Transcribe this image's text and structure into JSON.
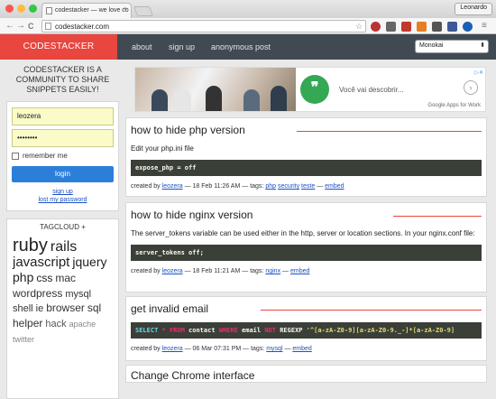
{
  "browser": {
    "tab_title": "codestacker — we love co",
    "tab_close": "×",
    "url": "codestacker.com",
    "user": "Leonardo",
    "back": "←",
    "forward": "→",
    "reload": "C",
    "star": "☆",
    "menu": "≡"
  },
  "header": {
    "brand": "CODESTACKER",
    "nav": [
      "about",
      "sign up",
      "anonymous post"
    ],
    "theme": "Monokai",
    "theme_arrow": "⬍"
  },
  "sidebar": {
    "tagline": "CODESTACKER IS A COMMUNITY TO SHARE SNIPPETS EASILY!",
    "username": "leozera",
    "password": "••••••••",
    "remember": "remember me",
    "login": "login",
    "signup": "sign up",
    "lost_password": "lost my password",
    "tagcloud_title": "TAGCLOUD +",
    "tags": [
      {
        "text": "ruby",
        "size": 20
      },
      {
        "text": "rails",
        "size": 16
      },
      {
        "text": "javascript",
        "size": 15
      },
      {
        "text": "jquery",
        "size": 14
      },
      {
        "text": "php",
        "size": 14
      },
      {
        "text": "css",
        "size": 12
      },
      {
        "text": "mac",
        "size": 12
      },
      {
        "text": "wordpress",
        "size": 12
      },
      {
        "text": "mysql",
        "size": 11
      },
      {
        "text": "shell",
        "size": 11
      },
      {
        "text": "ie",
        "size": 11
      },
      {
        "text": "browser",
        "size": 12
      },
      {
        "text": "sql",
        "size": 12
      },
      {
        "text": "helper",
        "size": 12
      },
      {
        "text": "hack",
        "size": 11
      },
      {
        "text": "apache",
        "size": 9
      },
      {
        "text": "twitter",
        "size": 9
      }
    ]
  },
  "ad": {
    "text": "Você vai descobrir...",
    "logo": "Google Apps for Work",
    "info": "▷✕"
  },
  "posts": [
    {
      "title": "how to hide php version",
      "desc": "Edit your php.ini file",
      "code": "expose_php = off",
      "meta_prefix": "created by",
      "author": "leozera",
      "date": "— 18 Feb 11:26 AM — tags:",
      "tags": [
        "php",
        "security",
        "teste"
      ],
      "sep": "—",
      "embed": "embed"
    },
    {
      "title": "how to hide nginx version",
      "desc": "The server_tokens variable can be used either in the http, server or location sections. In your nginx.conf file:",
      "code": "server_tokens off;",
      "meta_prefix": "created by",
      "author": "leozera",
      "date": "— 18 Feb 11:21 AM — tags:",
      "tags": [
        "nginx"
      ],
      "sep": "—",
      "embed": "embed"
    },
    {
      "title": "get invalid email",
      "code_parts": [
        "SELECT",
        " * ",
        "FROM",
        " contact ",
        "WHERE",
        " email ",
        "NOT",
        " ",
        "REGEXP",
        " '^[a-zA-Z0-9][a-zA-Z0-9._-]*[a-zA-Z0-9]"
      ],
      "meta_prefix": "created by",
      "author": "leozera",
      "date": "— 06 Mar 07:31 PM — tags:",
      "tags": [
        "mysql"
      ],
      "sep": "—",
      "embed": "embed"
    },
    {
      "title": "Change Chrome interface"
    }
  ]
}
